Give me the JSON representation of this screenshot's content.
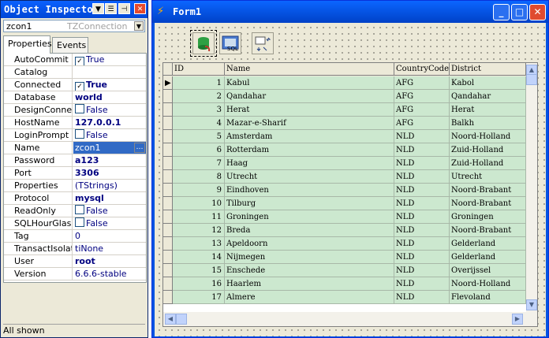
{
  "inspector": {
    "title": "Object Inspector",
    "component_name": "zcon1",
    "component_class": "TZConnection",
    "tabs": [
      {
        "label": "Properties"
      },
      {
        "label": "Events"
      }
    ],
    "properties": [
      {
        "name": "AutoCommit",
        "value": "True",
        "checkbox": true,
        "checked": true
      },
      {
        "name": "Catalog",
        "value": ""
      },
      {
        "name": "Connected",
        "value": "True",
        "checkbox": true,
        "checked": true,
        "bold": true
      },
      {
        "name": "Database",
        "value": "world",
        "bold": true
      },
      {
        "name": "DesignConnect",
        "value": "False",
        "checkbox": true,
        "checked": false
      },
      {
        "name": "HostName",
        "value": "127.0.0.1",
        "bold": true
      },
      {
        "name": "LoginPrompt",
        "value": "False",
        "checkbox": true,
        "checked": false
      },
      {
        "name": "Name",
        "value": "zcon1",
        "selected": true
      },
      {
        "name": "Password",
        "value": "a123",
        "bold": true
      },
      {
        "name": "Port",
        "value": "3306",
        "bold": true
      },
      {
        "name": "Properties",
        "value": "(TStrings)"
      },
      {
        "name": "Protocol",
        "value": "mysql",
        "bold": true
      },
      {
        "name": "ReadOnly",
        "value": "False",
        "checkbox": true,
        "checked": false
      },
      {
        "name": "SQLHourGlass",
        "value": "False",
        "checkbox": true,
        "checked": false
      },
      {
        "name": "Tag",
        "value": "0"
      },
      {
        "name": "TransactIsolation",
        "value": "tiNone"
      },
      {
        "name": "User",
        "value": "root",
        "bold": true
      },
      {
        "name": "Version",
        "value": "6.6.6-stable"
      }
    ],
    "status": "All shown"
  },
  "form": {
    "title": "Form1",
    "grid": {
      "columns": [
        "ID",
        "Name",
        "CountryCode",
        "District"
      ],
      "rows": [
        [
          "1",
          "Kabul",
          "AFG",
          "Kabol"
        ],
        [
          "2",
          "Qandahar",
          "AFG",
          "Qandahar"
        ],
        [
          "3",
          "Herat",
          "AFG",
          "Herat"
        ],
        [
          "4",
          "Mazar-e-Sharif",
          "AFG",
          "Balkh"
        ],
        [
          "5",
          "Amsterdam",
          "NLD",
          "Noord-Holland"
        ],
        [
          "6",
          "Rotterdam",
          "NLD",
          "Zuid-Holland"
        ],
        [
          "7",
          "Haag",
          "NLD",
          "Zuid-Holland"
        ],
        [
          "8",
          "Utrecht",
          "NLD",
          "Utrecht"
        ],
        [
          "9",
          "Eindhoven",
          "NLD",
          "Noord-Brabant"
        ],
        [
          "10",
          "Tilburg",
          "NLD",
          "Noord-Brabant"
        ],
        [
          "11",
          "Groningen",
          "NLD",
          "Groningen"
        ],
        [
          "12",
          "Breda",
          "NLD",
          "Noord-Brabant"
        ],
        [
          "13",
          "Apeldoorn",
          "NLD",
          "Gelderland"
        ],
        [
          "14",
          "Nijmegen",
          "NLD",
          "Gelderland"
        ],
        [
          "15",
          "Enschede",
          "NLD",
          "Overijssel"
        ],
        [
          "16",
          "Haarlem",
          "NLD",
          "Noord-Holland"
        ],
        [
          "17",
          "Almere",
          "NLD",
          "Flevoland"
        ]
      ]
    }
  },
  "colors": {
    "titlebar": "#0054e3",
    "row_bg": "#cce8cf",
    "selection": "#316ac5"
  }
}
